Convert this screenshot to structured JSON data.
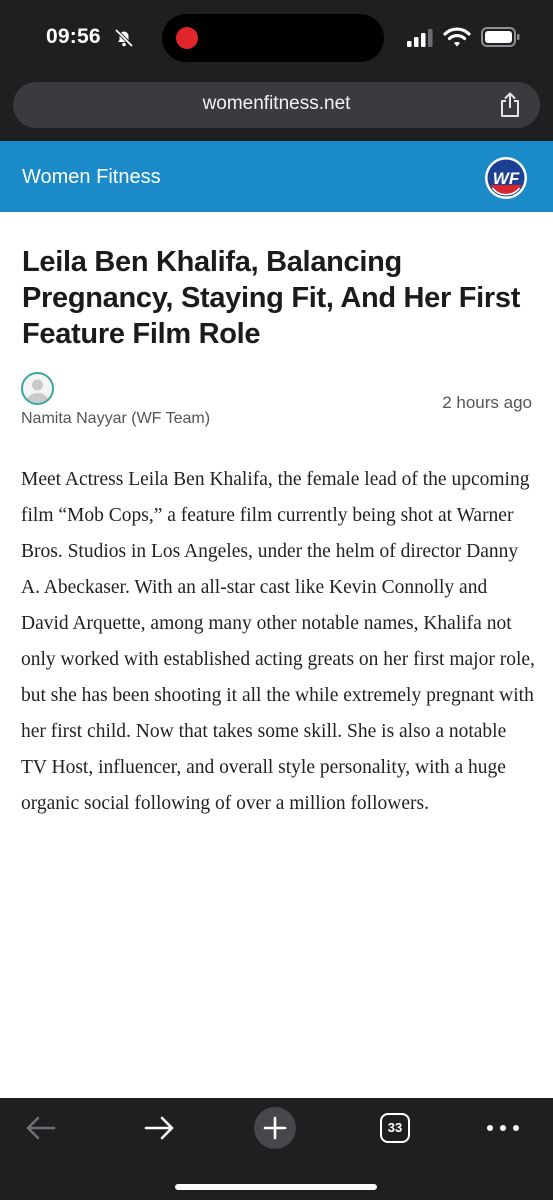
{
  "status_bar": {
    "time": "09:56"
  },
  "browser": {
    "address": "womenfitness.net",
    "tab_count": "33"
  },
  "site": {
    "name": "Women Fitness",
    "logo_text": "WF"
  },
  "article": {
    "title": "Leila Ben Khalifa, Balancing Pregnancy, Staying Fit, And Her First Feature Film Role",
    "author": "Namita Nayyar (WF Team)",
    "posted": "2 hours ago",
    "body": "Meet Actress Leila Ben Khalifa, the female lead of the upcoming film “Mob Cops,” a feature film currently being shot at Warner Bros. Studios in Los Angeles, under the helm of director Danny A. Abeckaser. With an all-star cast like Kevin Connolly and David Arquette, among many other notable names, Khalifa not only worked with established acting greats on her first major role, but she has been shooting it all the while extremely pregnant with her first child. Now that takes some skill. She is also a notable TV Host,  influencer, and overall style personality, with a huge organic social following of over a million followers."
  },
  "icons": {
    "status": [
      "bell-slash-icon",
      "recording-dot-icon",
      "cellular-signal-icon",
      "wifi-icon",
      "battery-icon"
    ],
    "toolbar": [
      "back-arrow-icon",
      "forward-arrow-icon",
      "plus-icon",
      "tabs-icon",
      "more-icon"
    ],
    "address": "share-icon"
  },
  "colors": {
    "header_blue": "#1a8ac8",
    "chrome_dark": "#1e1f21",
    "recording_red": "#e0262b",
    "avatar_ring": "#38a7a0"
  }
}
